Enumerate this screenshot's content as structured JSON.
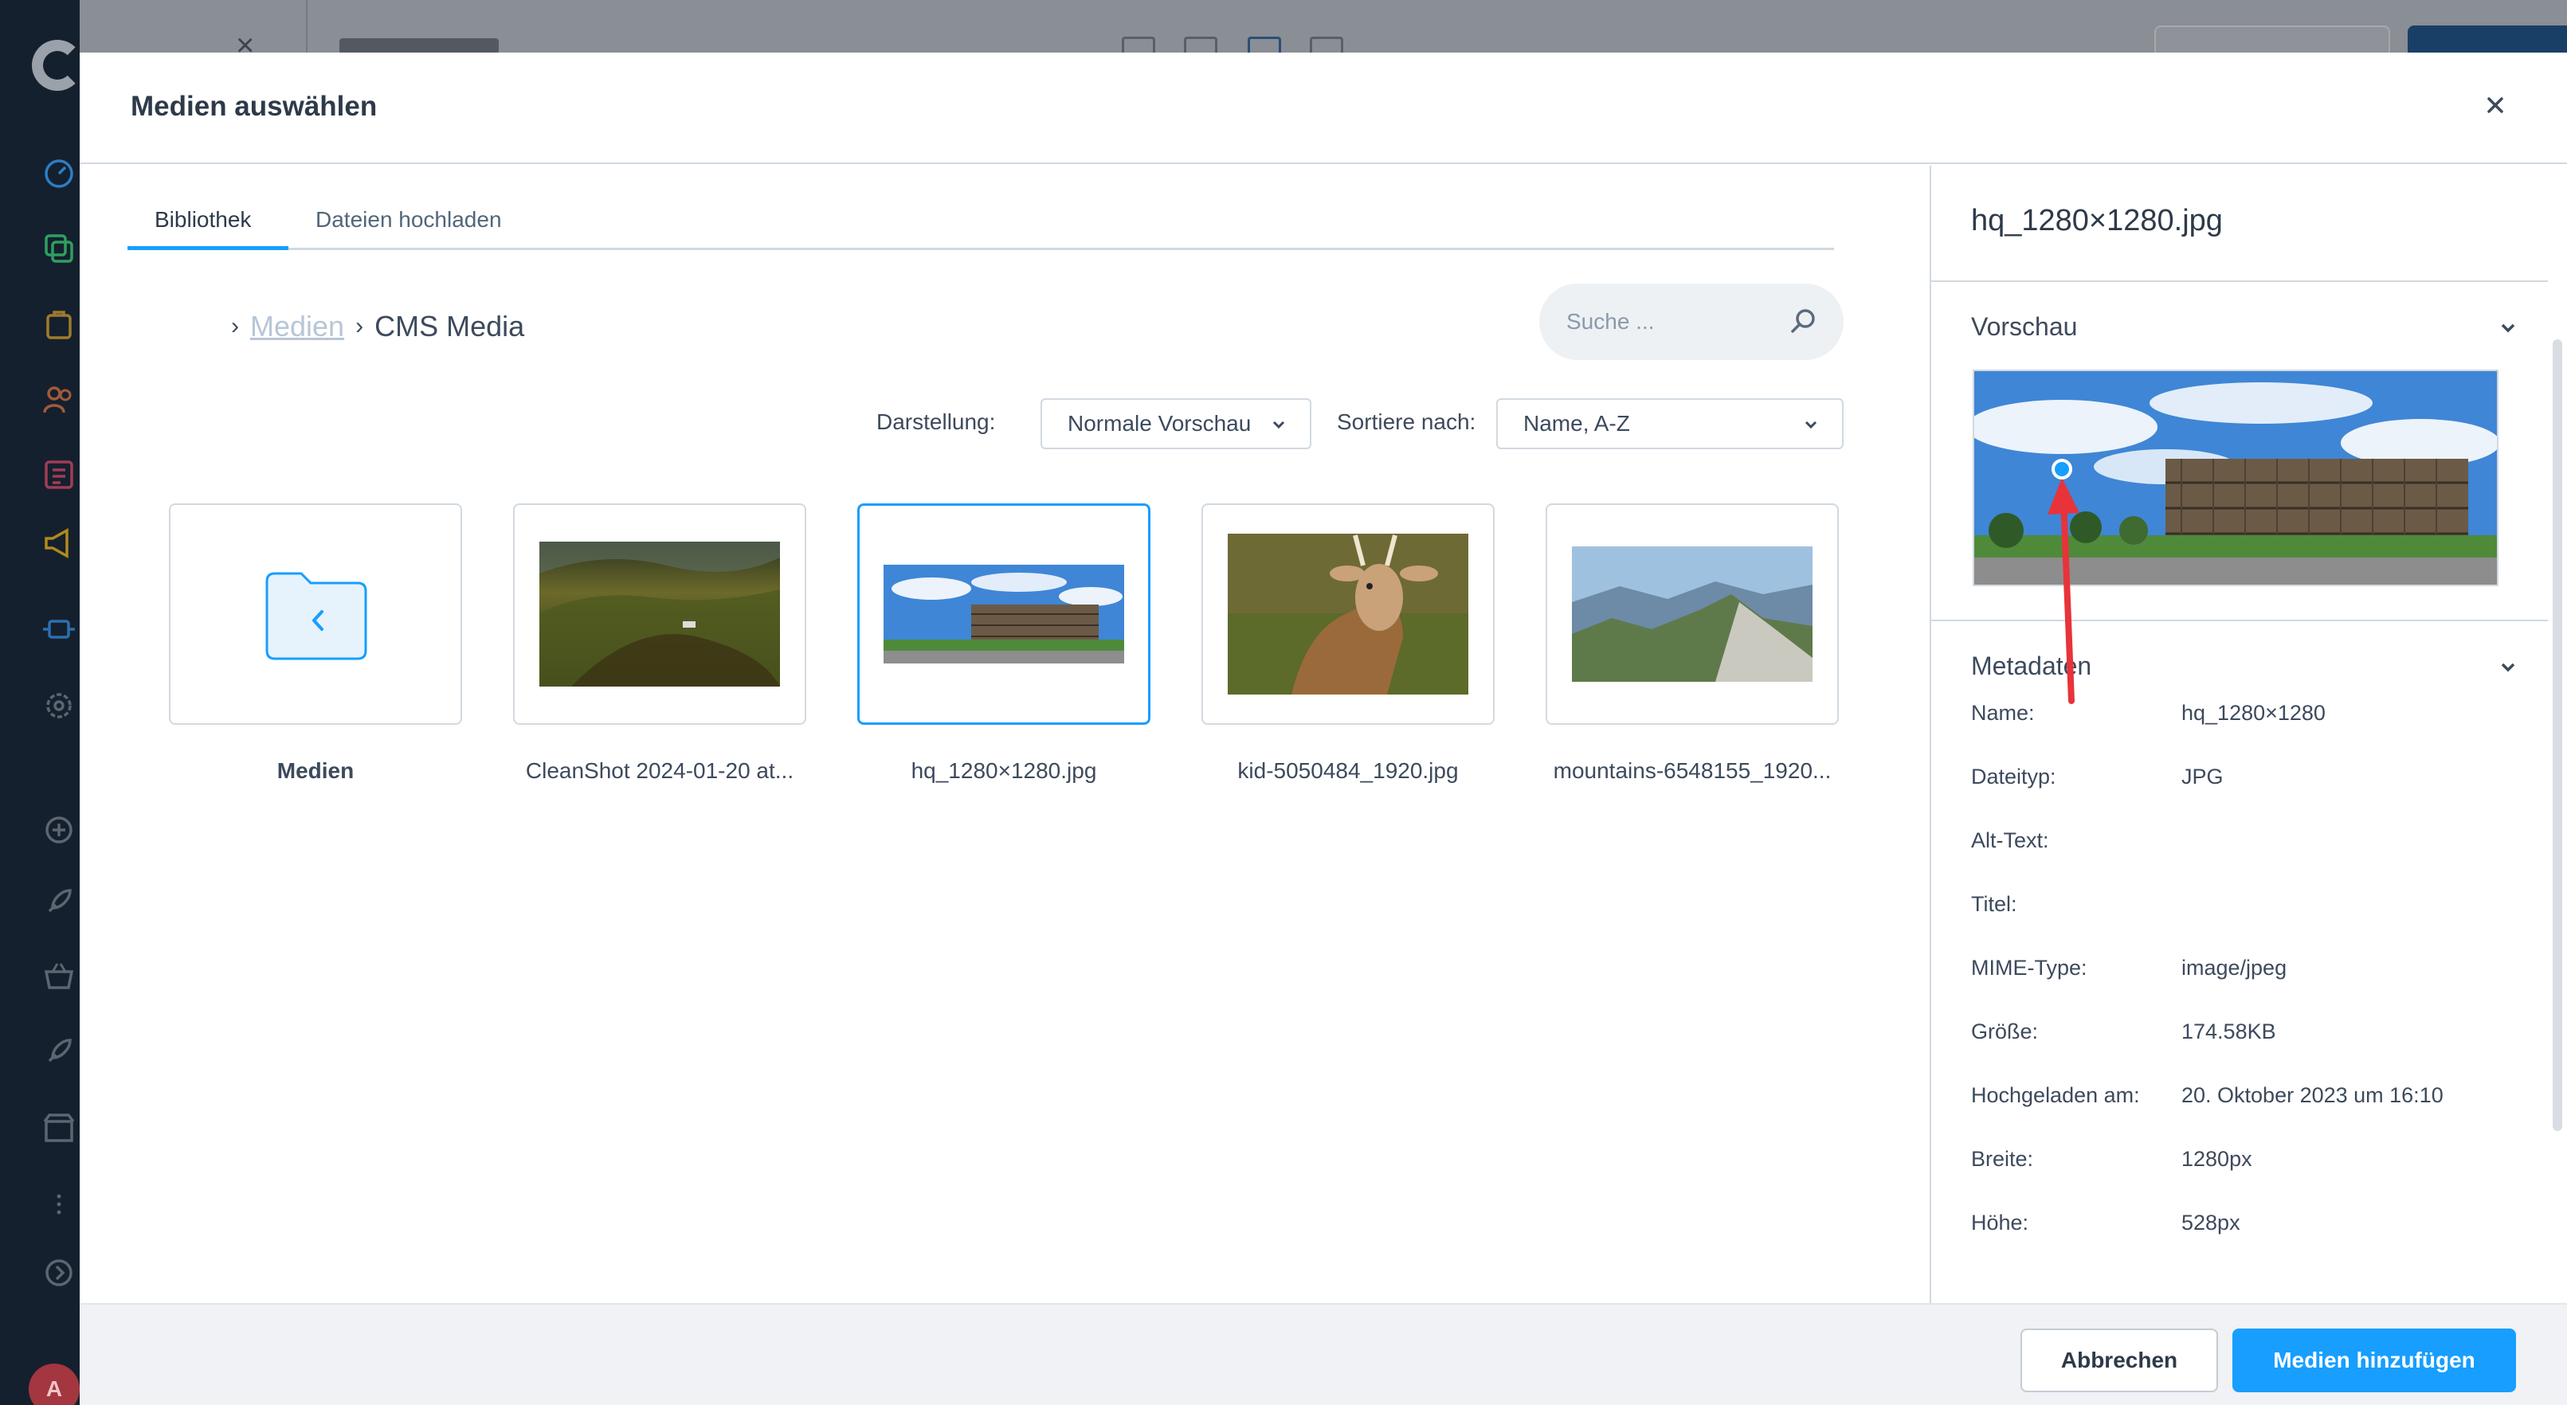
{
  "background": {
    "logo": "shopware-logo",
    "avatar_letter": "A",
    "sidebar_icons": [
      "dashboard-icon",
      "catalogue-icon",
      "orders-icon",
      "customers-icon",
      "content-icon",
      "marketing-icon",
      "extensions-icon",
      "settings-icon",
      "add-icon",
      "rocket-icon",
      "basket-icon",
      "rocket-icon",
      "store-icon",
      "more-icon",
      "collapse-icon"
    ]
  },
  "modal": {
    "title": "Medien auswählen",
    "close_icon": "close-icon"
  },
  "tabs": [
    {
      "label": "Bibliothek",
      "active": true
    },
    {
      "label": "Dateien hochladen",
      "active": false
    }
  ],
  "breadcrumb": {
    "items": [
      "Medien",
      "CMS Media"
    ]
  },
  "search": {
    "placeholder": "Suche ..."
  },
  "controls": {
    "display_label": "Darstellung:",
    "display_value": "Normale Vorschau",
    "sort_label": "Sortiere nach:",
    "sort_value": "Name, A-Z"
  },
  "tiles": [
    {
      "name": "Medien",
      "type": "folder"
    },
    {
      "name": "CleanShot 2024-01-20 at...",
      "type": "image"
    },
    {
      "name": "hq_1280×1280.jpg",
      "type": "image",
      "selected": true
    },
    {
      "name": "kid-5050484_1920.jpg",
      "type": "image"
    },
    {
      "name": "mountains-6548155_1920...",
      "type": "image"
    }
  ],
  "sidebar": {
    "file_title": "hq_1280×1280.jpg",
    "preview_heading": "Vorschau",
    "metadata_heading": "Metadaten",
    "metadata": [
      {
        "key": "Name:",
        "value": "hq_1280×1280"
      },
      {
        "key": "Dateityp:",
        "value": "JPG"
      },
      {
        "key": "Alt-Text:",
        "value": ""
      },
      {
        "key": "Titel:",
        "value": ""
      },
      {
        "key": "MIME-Type:",
        "value": "image/jpeg"
      },
      {
        "key": "Größe:",
        "value": "174.58KB"
      },
      {
        "key": "Hochgeladen am:",
        "value": "20. Oktober 2023 um 16:10"
      },
      {
        "key": "Breite:",
        "value": "1280px"
      },
      {
        "key": "Höhe:",
        "value": "528px"
      }
    ]
  },
  "footer": {
    "cancel_label": "Abbrechen",
    "add_label": "Medien hinzufügen"
  },
  "colors": {
    "accent": "#189eff",
    "sidebar_bg": "#15202e",
    "text": "#3d4a5c",
    "border": "#d1d9e0"
  }
}
